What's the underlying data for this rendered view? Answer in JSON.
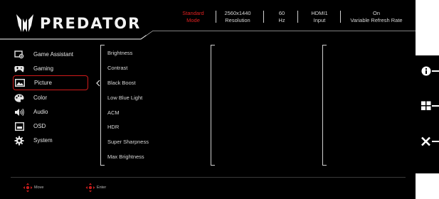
{
  "brand": {
    "name": "PREDATOR"
  },
  "status": [
    {
      "value": "Standard",
      "label": "Mode",
      "highlight": true
    },
    {
      "value": "2560x1440",
      "label": "Resolution",
      "highlight": false
    },
    {
      "value": "60",
      "label": "Hz",
      "highlight": false
    },
    {
      "value": "HDMI1",
      "label": "Input",
      "highlight": false
    },
    {
      "value": "On",
      "label": "Variable Refresh Rate",
      "highlight": false
    }
  ],
  "menu": [
    {
      "label": "Game Assistant",
      "icon": "game-assistant-icon"
    },
    {
      "label": "Gaming",
      "icon": "gamepad-icon"
    },
    {
      "label": "Picture",
      "icon": "picture-icon",
      "selected": true
    },
    {
      "label": "Color",
      "icon": "palette-icon"
    },
    {
      "label": "Audio",
      "icon": "speaker-icon"
    },
    {
      "label": "OSD",
      "icon": "osd-window-icon"
    },
    {
      "label": "System",
      "icon": "gear-icon"
    }
  ],
  "submenu": [
    "Brightness",
    "Contrast",
    "Black Boost",
    "Low Blue Light",
    "ACM",
    "HDR",
    "Super Sharpness",
    "Max Brightness"
  ],
  "footer": {
    "move_label": "Move",
    "enter_label": "Enter"
  },
  "side_keys": [
    "info-icon",
    "menu-grid-icon",
    "close-icon"
  ],
  "colors": {
    "accent": "#e02121",
    "background": "#000000",
    "text": "#e6e6e6"
  }
}
